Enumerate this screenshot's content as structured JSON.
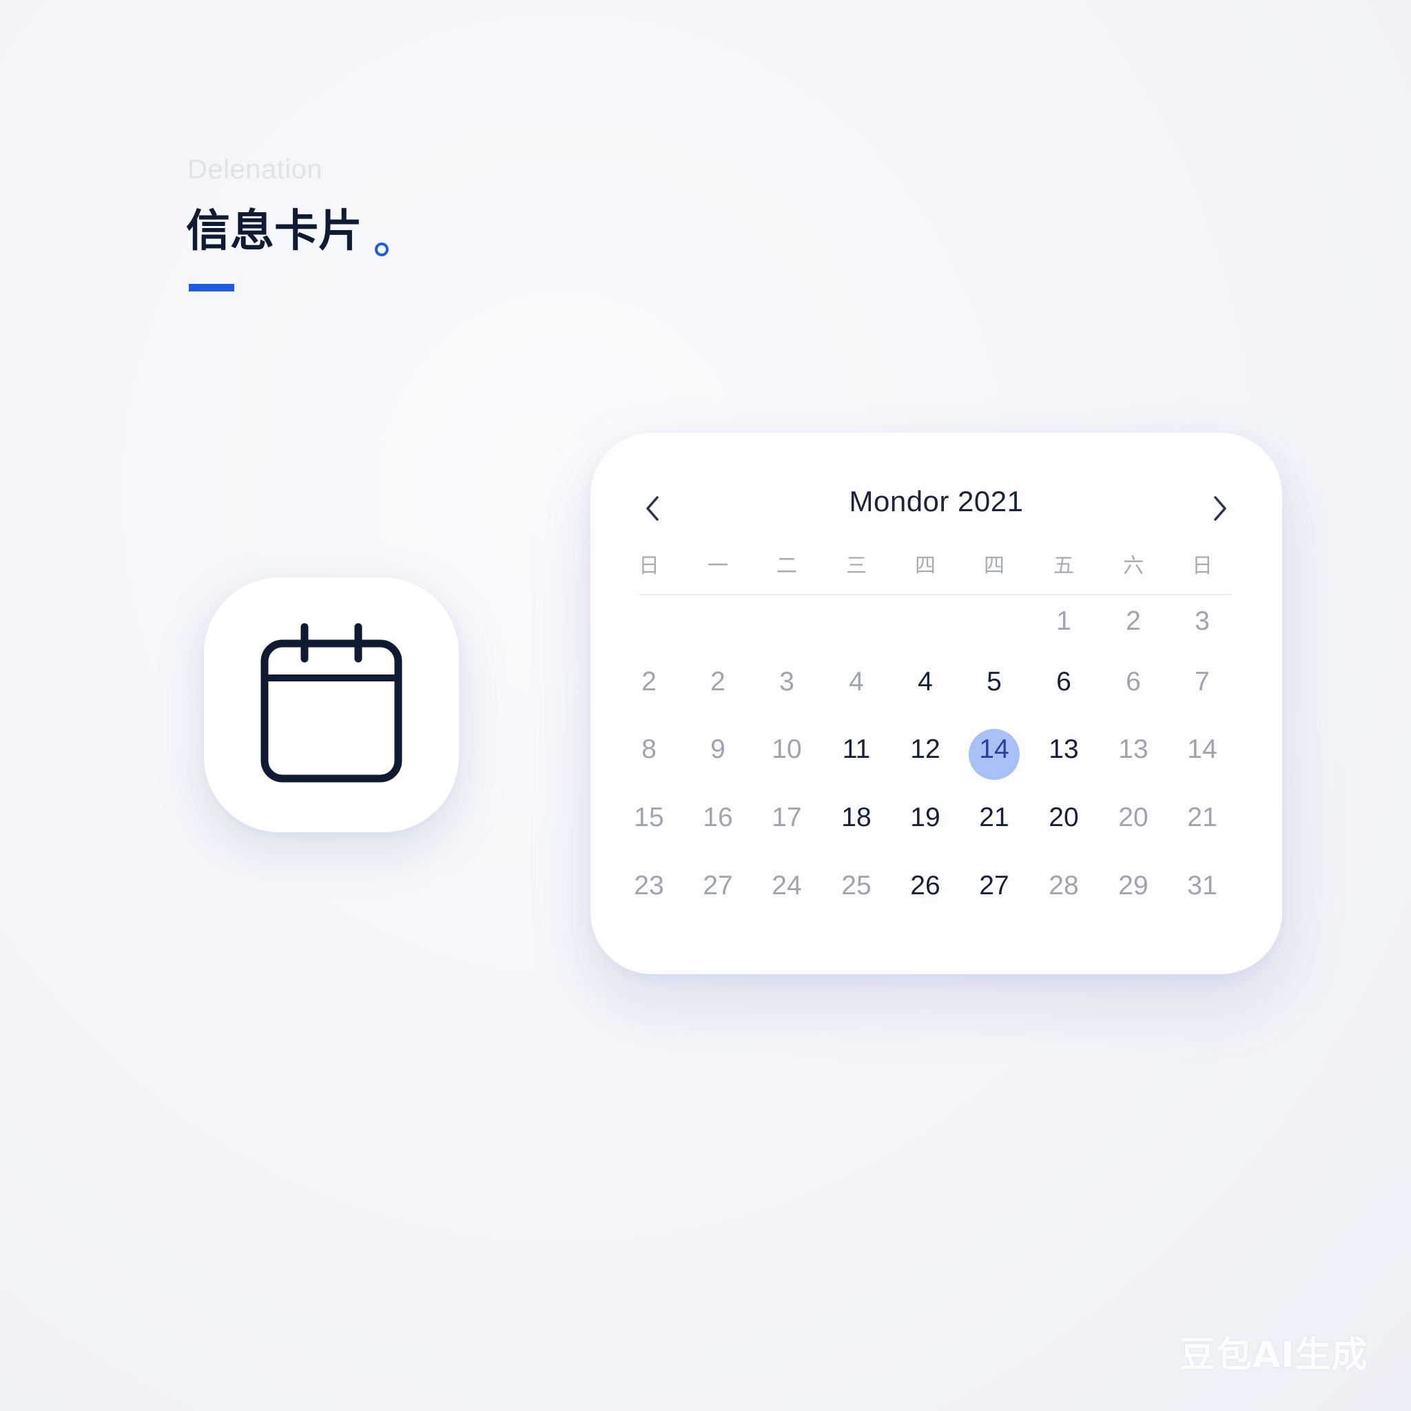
{
  "header": {
    "eyebrow": "Delenation",
    "title": "信息卡片"
  },
  "colors": {
    "accent": "#1f5ce6",
    "title": "#0f1a33",
    "selected_day_bg": "#a7c1f6",
    "muted_day": "#9ea4b1"
  },
  "icon_tile": {
    "icon": "calendar-icon"
  },
  "calendar": {
    "month_label": "Mondor 2021",
    "prev_icon": "chevron-left-icon",
    "next_icon": "chevron-right-icon",
    "weekdays": [
      "日",
      "一",
      "二",
      "三",
      "四",
      "四",
      "五",
      "六",
      "日"
    ],
    "weeks": [
      [
        null,
        null,
        null,
        null,
        null,
        null,
        "1",
        "2",
        "3"
      ],
      [
        "2",
        "2",
        "3",
        "4",
        "4",
        "5",
        "6",
        "6",
        "7"
      ],
      [
        "8",
        "9",
        "10",
        "11",
        "12",
        "14",
        "13",
        "13",
        "14"
      ],
      [
        "15",
        "16",
        "17",
        "18",
        "19",
        "21",
        "20",
        "20",
        "21"
      ],
      [
        "23",
        "27",
        "24",
        "25",
        "26",
        "27",
        "28",
        "29",
        "31"
      ]
    ],
    "strong": [
      [],
      [
        4,
        5,
        6
      ],
      [
        3,
        4,
        6
      ],
      [
        3,
        4,
        5,
        6
      ],
      [
        4,
        5
      ]
    ],
    "selected": {
      "week": 2,
      "col": 5
    }
  },
  "watermark": "豆包AI生成"
}
